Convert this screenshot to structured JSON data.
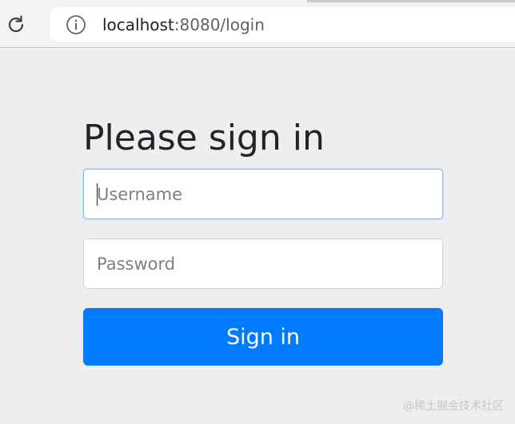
{
  "browser": {
    "url_host": "localhost",
    "url_path": ":8080/login"
  },
  "page": {
    "title": "Please sign in"
  },
  "form": {
    "username": {
      "placeholder": "Username",
      "value": "",
      "focused": true
    },
    "password": {
      "placeholder": "Password",
      "value": ""
    },
    "submit_label": "Sign in"
  },
  "watermark": "@稀土掘金技术社区",
  "colors": {
    "page_background": "#eeeeee",
    "primary_button": "#007bff",
    "focus_border": "#80bdff"
  },
  "icons": {
    "reload": "reload-icon",
    "site_info": "info-icon"
  }
}
